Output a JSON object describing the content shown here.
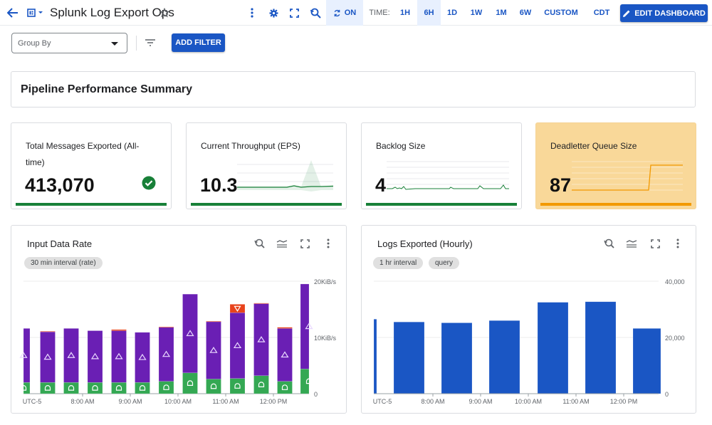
{
  "header": {
    "title": "Splunk Log Export Ops",
    "auto_refresh_label": "ON",
    "time_label": "TIME:",
    "time_options": [
      "1H",
      "6H",
      "1D",
      "1W",
      "1M",
      "6W",
      "CUSTOM"
    ],
    "selected_time": "6H",
    "timezone": "CDT",
    "edit_label": "EDIT DASHBOARD",
    "accent_color": "#1a56c4"
  },
  "filters": {
    "group_by_placeholder": "Group By",
    "add_filter_label": "ADD FILTER"
  },
  "section": {
    "title": "Pipeline Performance Summary"
  },
  "kpis": [
    {
      "label": "Total Messages Exported (All-time)",
      "value": "413,070",
      "status": "ok",
      "bar_color": "#188038"
    },
    {
      "label": "Current Throughput (EPS)",
      "value": "10.3",
      "bar_color": "#188038"
    },
    {
      "label": "Backlog Size",
      "value": "4",
      "bar_color": "#188038"
    },
    {
      "label": "Deadletter Queue Size",
      "value": "87",
      "bar_color": "#f29900",
      "background": "#f9d899"
    }
  ],
  "charts": {
    "input_rate": {
      "title": "Input Data Rate",
      "chips": [
        "30 min interval (rate)"
      ]
    },
    "logs_exported": {
      "title": "Logs Exported (Hourly)",
      "chips": [
        "1 hr interval",
        "query"
      ]
    }
  },
  "chart_data": [
    {
      "type": "bar",
      "stacked": true,
      "title": "Input Data Rate",
      "ylabel": "KiB/s",
      "ylim": [
        0,
        20
      ],
      "yticks": [
        "0",
        "10KiB/s",
        "20KiB/s"
      ],
      "xticks": [
        "UTC-5",
        "8:00 AM",
        "9:00 AM",
        "10:00 AM",
        "11:00 AM",
        "12:00 PM"
      ],
      "categories": [
        "7:00",
        "7:30",
        "8:00",
        "8:30",
        "9:00",
        "9:30",
        "10:00",
        "10:30",
        "11:00",
        "11:30",
        "12:00",
        "12:30",
        "13:00"
      ],
      "series": [
        {
          "name": "green",
          "color": "#34a853",
          "values": [
            2.0,
            2.0,
            2.0,
            2.0,
            2.0,
            2.0,
            2.2,
            3.7,
            2.6,
            2.7,
            3.2,
            2.2,
            4.4
          ]
        },
        {
          "name": "purple",
          "color": "#6a1fb4",
          "values": [
            9.6,
            9.0,
            9.6,
            9.2,
            9.2,
            8.9,
            9.6,
            14.0,
            10.2,
            11.7,
            12.8,
            9.4,
            15.1
          ]
        },
        {
          "name": "red",
          "color": "#e8431b",
          "values": [
            0,
            0.1,
            0,
            0,
            0.2,
            0,
            0.1,
            0,
            0.1,
            1.5,
            0.1,
            0.2,
            0
          ]
        }
      ],
      "grid": true,
      "legend": "none"
    },
    {
      "type": "bar",
      "title": "Logs Exported (Hourly)",
      "ylim": [
        0,
        40000
      ],
      "yticks": [
        "0",
        "20,000",
        "40,000"
      ],
      "xticks": [
        "UTC-5",
        "8:00 AM",
        "9:00 AM",
        "10:00 AM",
        "11:00 AM",
        "12:00 PM"
      ],
      "categories": [
        "7:00",
        "7:30",
        "8:30",
        "9:30",
        "10:30",
        "11:30",
        "12:30"
      ],
      "values": [
        26500,
        25500,
        25200,
        26000,
        32500,
        32700,
        23200
      ],
      "color": "#1a56c4",
      "grid": true,
      "legend": "none"
    }
  ]
}
